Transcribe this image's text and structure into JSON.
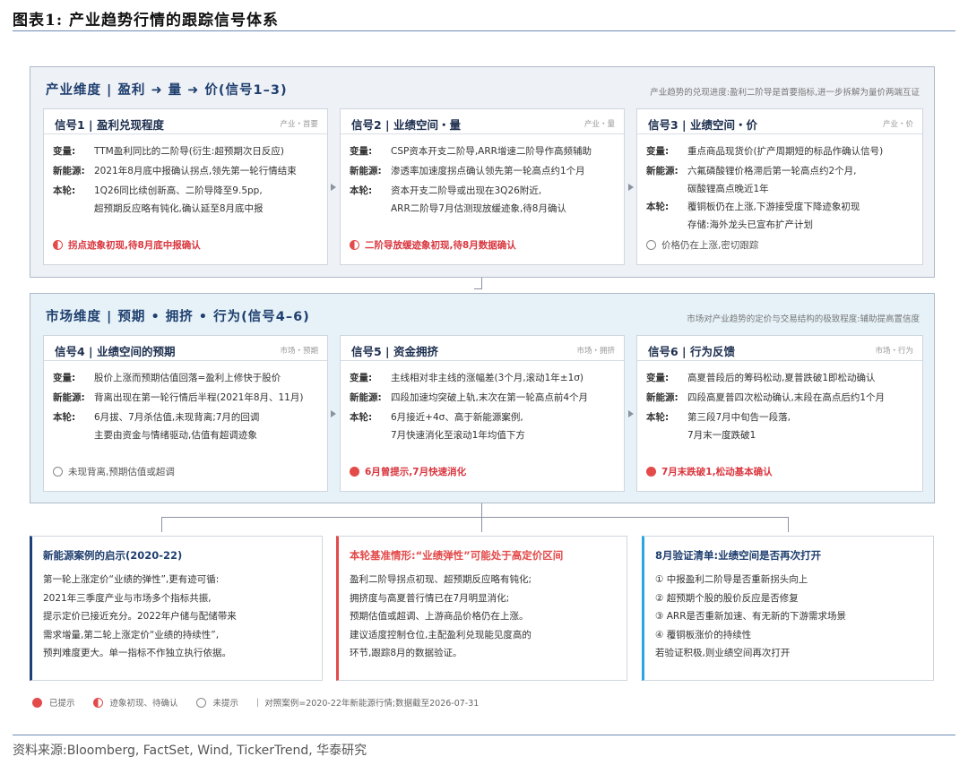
{
  "figure": {
    "title": "图表1:  产业趋势行情的跟踪信号体系",
    "source": "资料来源:Bloomberg, FactSet, Wind, TickerTrend, 华泰研究"
  },
  "panels": [
    {
      "title": "产业维度 | 盈利 ➜ 量 ➜ 价(信号1–3)",
      "note": "产业趋势的兑现进度:盈利二阶导是首要指标,进一步拆解为量价两端互证",
      "cards": [
        {
          "title": "信号1 | 盈利兑现程度",
          "tag": "产业・首要",
          "rows": [
            {
              "k": "变量:",
              "v": [
                "TTM盈利同比的二阶导(衍生:超预期次日反应)"
              ]
            },
            {
              "k": "新能源:",
              "v": [
                "2021年8月底中报确认拐点,领先第一轮行情结束"
              ]
            },
            {
              "k": "本轮:",
              "v": [
                "1Q26同比续创新高、二阶导降至9.5pp,",
                "超预期反应略有钝化,确认延至8月底中报"
              ]
            }
          ],
          "status": "拐点迹象初现,待8月底中报确认",
          "status_state": "half"
        },
        {
          "title": "信号2 | 业绩空间・量",
          "tag": "产业・量",
          "rows": [
            {
              "k": "变量:",
              "v": [
                "CSP资本开支二阶导,ARR增速二阶导作高频辅助"
              ]
            },
            {
              "k": "新能源:",
              "v": [
                "渗透率加速度拐点确认领先第一轮高点约1个月"
              ]
            },
            {
              "k": "本轮:",
              "v": [
                "资本开支二阶导或出现在3Q26附近,",
                "ARR二阶导7月估测现放缓迹象,待8月确认"
              ]
            }
          ],
          "status": "二阶导放缓迹象初现,待8月数据确认",
          "status_state": "half"
        },
        {
          "title": "信号3 | 业绩空间・价",
          "tag": "产业・价",
          "rows": [
            {
              "k": "变量:",
              "v": [
                "重点商品现货价(扩产周期短的标品作确认信号)"
              ]
            },
            {
              "k": "新能源:",
              "v": [
                "六氟磷酸锂价格滞后第一轮高点约2个月,",
                "碳酸锂高点晚近1年"
              ]
            },
            {
              "k": "本轮:",
              "v": [
                "覆铜板仍在上涨,下游接受度下降迹象初现",
                "存储:海外龙头已宣布扩产计划"
              ]
            }
          ],
          "status": "价格仍在上涨,密切跟踪",
          "status_state": "empty"
        }
      ]
    },
    {
      "title": "市场维度 | 预期 • 拥挤 • 行为(信号4–6)",
      "note": "市场对产业趋势的定价与交易结构的极致程度:辅助提高置信度",
      "cards": [
        {
          "title": "信号4 | 业绩空间的预期",
          "tag": "市场・预期",
          "rows": [
            {
              "k": "变量:",
              "v": [
                "股价上涨而预期估值回落=盈利上修快于股价"
              ]
            },
            {
              "k": "新能源:",
              "v": [
                "背离出现在第一轮行情后半程(2021年8月、11月)"
              ]
            },
            {
              "k": "本轮:",
              "v": [
                "6月拔、7月杀估值,未现背离;7月的回调",
                "主要由资金与情绪驱动,估值有超调迹象"
              ]
            }
          ],
          "status": "未现背离,预期估值或超调",
          "status_state": "empty"
        },
        {
          "title": "信号5 | 资金拥挤",
          "tag": "市场・拥挤",
          "rows": [
            {
              "k": "变量:",
              "v": [
                "主线相对非主线的涨幅差(3个月,滚动1年±1σ)"
              ]
            },
            {
              "k": "新能源:",
              "v": [
                "四段加速均突破上轨,末次在第一轮高点前4个月"
              ]
            },
            {
              "k": "本轮:",
              "v": [
                "6月接近+4σ、高于新能源案例,",
                "7月快速消化至滚动1年均值下方"
              ]
            }
          ],
          "status": "6月曾提示,7月快速消化",
          "status_state": "full"
        },
        {
          "title": "信号6 | 行为反馈",
          "tag": "市场・行为",
          "rows": [
            {
              "k": "变量:",
              "v": [
                "高夏普段后的筹码松动,夏普跌破1即松动确认"
              ]
            },
            {
              "k": "新能源:",
              "v": [
                "四段高夏普四次松动确认,末段在高点后约1个月"
              ]
            },
            {
              "k": "本轮:",
              "v": [
                "第三段7月中旬告一段落,",
                "7月末一度跌破1"
              ]
            }
          ],
          "status": "7月末跌破1,松动基本确认",
          "status_state": "full"
        }
      ]
    }
  ],
  "bottom_cards": [
    {
      "title": "新能源案例的启示(2020-22)",
      "lines": [
        "第一轮上涨定价“业绩的弹性”,更有迹可循:",
        "2021年三季度产业与市场多个指标共振,",
        "提示定价已接近充分。2022年户储与配储带来",
        "需求增量,第二轮上涨定价“业绩的持续性”,",
        "预判难度更大。单一指标不作独立执行依据。"
      ]
    },
    {
      "title": "本轮基准情形:“业绩弹性”可能处于高定价区间",
      "lines": [
        "盈利二阶导拐点初现、超预期反应略有钝化;",
        "拥挤度与高夏普行情已在7月明显消化;",
        "预期估值或超调、上游商品价格仍在上涨。",
        "建议适度控制仓位,主配盈利兑现能见度高的",
        "环节,跟踪8月的数据验证。"
      ]
    },
    {
      "title": "8月验证清单:业绩空间是否再次打开",
      "lines": [
        "① 中报盈利二阶导是否重新拐头向上",
        "② 超预期个股的股价反应是否修复",
        "③ ARR是否重新加速、有无新的下游需求场景",
        "④ 覆铜板涨价的持续性",
        "若验证积极,则业绩空间再次打开"
      ]
    }
  ],
  "legend": {
    "full": "已提示",
    "half": "迹象初现、待确认",
    "empty": "未提示",
    "note": "对照案例=2020-22年新能源行情;数据截至2026-07-31"
  },
  "colors": {
    "accent_red": "#e34a4a",
    "navy": "#1f3f6f",
    "cyan": "#2aa6de",
    "panel_a_bg": "#eef1f6",
    "panel_b_bg": "#e6f2f8"
  }
}
